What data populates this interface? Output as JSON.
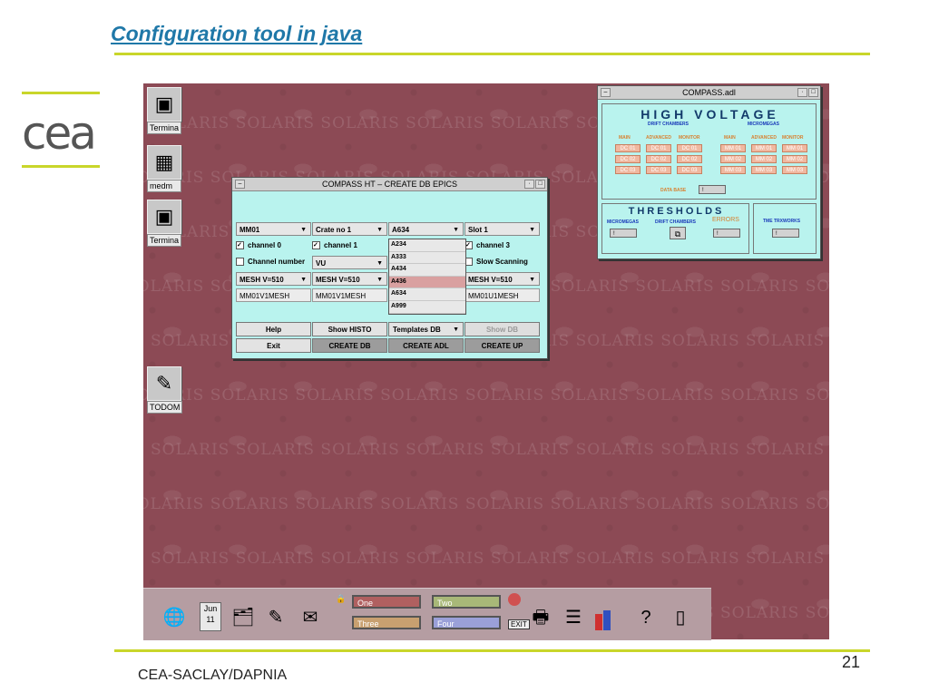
{
  "slide": {
    "title": "Configuration tool in java",
    "footer": "CEA-SACLAY/DAPNIA",
    "page_number": "21",
    "logo_text": "cea"
  },
  "desktop": {
    "watermark": "SOLARIS",
    "icons": [
      {
        "label": "Termina",
        "icon": "terminal-icon"
      },
      {
        "label": "medm",
        "icon": "medm-icon"
      },
      {
        "label": "Termina",
        "icon": "terminal-icon"
      },
      {
        "label": "TODOM",
        "icon": "todom-icon"
      }
    ]
  },
  "epics_window": {
    "title": "COMPASS HT – CREATE DB EPICS",
    "selects": [
      "MM01",
      "Crate no 1",
      "A634",
      "Slot 1"
    ],
    "checkboxes": [
      "channel 0",
      "channel 1",
      "channel 3"
    ],
    "channel_number_label": "Channel number",
    "vu_select": "VU",
    "slow_scanning_label": "Slow Scanning",
    "mesh_selects": [
      "MESH V=510",
      "MESH V=510",
      "MESH V=510"
    ],
    "names": [
      "MM01V1MESH",
      "MM01V1MESH",
      "MM01U1MESH"
    ],
    "dropdown_options": [
      "A234",
      "A333",
      "A434",
      "A436",
      "A634",
      "A999"
    ],
    "dropdown_selected": "A436",
    "buttons_row1": [
      "Help",
      "Show  HISTO",
      "Templates DB",
      "Show  DB"
    ],
    "buttons_row2": [
      "Exit",
      "CREATE  DB",
      "CREATE ADL",
      "CREATE UP"
    ]
  },
  "adl_window": {
    "title": "COMPASS.adl",
    "hv_title": "HIGH VOLTAGE",
    "drift_chambers": "DRIFT CHAMBERS",
    "micromegas": "MICROMEGAS",
    "col_headers": [
      "MAIN",
      "ADVANCED",
      "MONITOR",
      "MAIN",
      "ADVANCED",
      "MONITOR"
    ],
    "dc_rows": [
      "DC 01",
      "DC 02",
      "DC 03"
    ],
    "mm_rows": [
      "MM 01",
      "MM 02",
      "MM 03"
    ],
    "data_base": "DATA BASE",
    "thresholds_title": "THRESHOLDS",
    "thr_micromegas": "MICROMEGAS",
    "thr_drift": "DRIFT CHAMBERS",
    "errors": "ERRORS",
    "tme": "TME TRXWORKS",
    "btn_label": "!"
  },
  "taskbar": {
    "date_month": "Jun",
    "date_day": "11",
    "workspaces": [
      {
        "name": "One",
        "color": "#b06060"
      },
      {
        "name": "Two",
        "color": "#a8b878"
      },
      {
        "name": "Three",
        "color": "#c8a070"
      },
      {
        "name": "Four",
        "color": "#9aa0d8"
      }
    ],
    "exit_label": "EXIT"
  }
}
